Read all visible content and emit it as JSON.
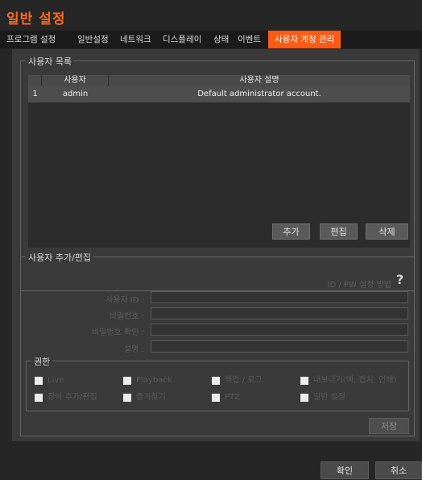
{
  "window": {
    "title": "일반 설정"
  },
  "tabs": [
    {
      "label": "프로그램 설정"
    },
    {
      "label": "일반설정"
    },
    {
      "label": "네트워크"
    },
    {
      "label": "디스플레이"
    },
    {
      "label": "상태"
    },
    {
      "label": "이벤트"
    },
    {
      "label": "사용자 계정 관리"
    }
  ],
  "user_list": {
    "legend": "사용자 목록",
    "columns": [
      "사용자",
      "사용자 설명"
    ],
    "rows": [
      {
        "index": "1",
        "user": "admin",
        "description": "Default administrator account."
      }
    ],
    "buttons": {
      "add": "추가",
      "edit": "편집",
      "delete": "삭제"
    }
  },
  "user_edit": {
    "legend": "사용자 추가/편집",
    "help_link": "ID / PW 설정 방법",
    "help_icon": "?",
    "fields": {
      "user_id": "사용자 ID :",
      "password": "비밀번호 :",
      "password_confirm": "비밀번호 확인 :",
      "description": "설명 :"
    },
    "permissions": {
      "legend": "권한",
      "items": [
        "Live",
        "Playback",
        "백업 / 로그",
        "내보내기(메, 캡쳐, 인쇄)",
        "장비 추가/편집",
        "즐겨찾기",
        "PTZ",
        "일반 설정"
      ]
    },
    "save": "저장"
  },
  "footer": {
    "ok": "확인",
    "cancel": "취소"
  }
}
